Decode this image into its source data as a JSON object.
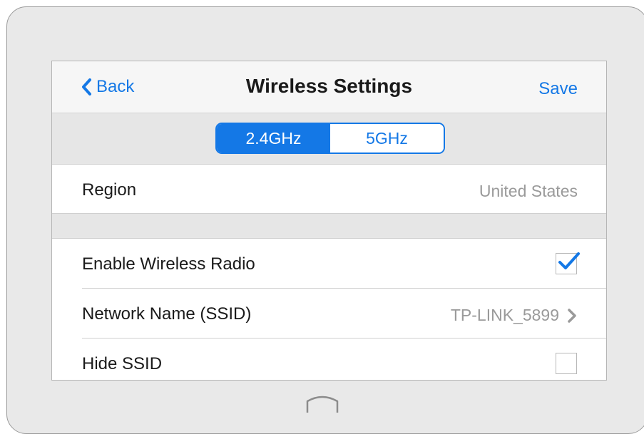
{
  "navbar": {
    "back_label": "Back",
    "title": "Wireless Settings",
    "save_label": "Save"
  },
  "bands": {
    "options": [
      "2.4GHz",
      "5GHz"
    ],
    "selected": "2.4GHz"
  },
  "region": {
    "label": "Region",
    "value": "United States"
  },
  "settings": {
    "enable_radio": {
      "label": "Enable Wireless Radio",
      "checked": true
    },
    "ssid": {
      "label": "Network Name (SSID)",
      "value": "TP-LINK_5899"
    },
    "hide_ssid": {
      "label": "Hide SSID",
      "checked": false
    }
  },
  "colors": {
    "accent": "#1478e6",
    "device_bezel": "#e9e9e9",
    "secondary_text": "#9a9a9a"
  },
  "icons": {
    "back": "chevron-left-icon",
    "ssid_arrow": "chevron-right-icon",
    "check": "checkmark-icon",
    "home": "home-button-icon"
  }
}
